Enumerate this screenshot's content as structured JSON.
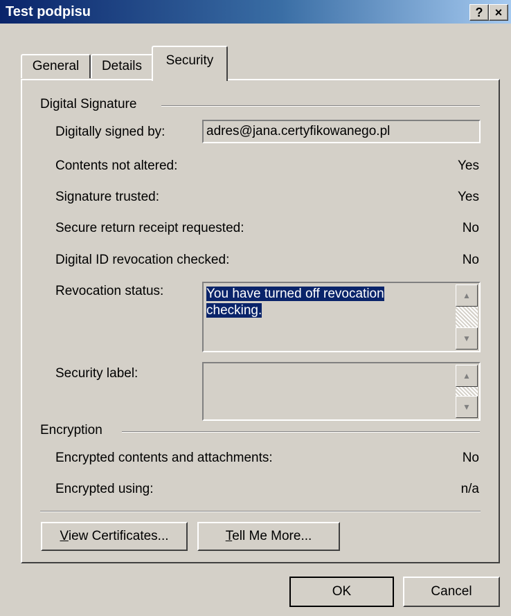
{
  "window": {
    "title": "Test podpisu",
    "help_label": "?",
    "close_label": "×"
  },
  "tabs": [
    {
      "label": "General",
      "active": false
    },
    {
      "label": "Details",
      "active": false
    },
    {
      "label": "Security",
      "active": true
    }
  ],
  "digital_signature": {
    "heading": "Digital Signature",
    "signed_by_label": "Digitally signed by:",
    "signed_by_value": "adres@jana.certyfikowanego.pl",
    "rows": [
      {
        "label": "Contents not altered:",
        "value": "Yes"
      },
      {
        "label": "Signature trusted:",
        "value": "Yes"
      },
      {
        "label": "Secure return receipt requested:",
        "value": "No"
      },
      {
        "label": "Digital ID revocation checked:",
        "value": "No"
      }
    ],
    "revocation_label": "Revocation status:",
    "revocation_text_line1": "You have turned off revocation",
    "revocation_text_line2": "checking.",
    "security_label": "Security label:"
  },
  "encryption": {
    "heading": "Encryption",
    "rows": [
      {
        "label": "Encrypted contents and attachments:",
        "value": "No"
      },
      {
        "label": "Encrypted using:",
        "value": "n/a"
      }
    ]
  },
  "buttons": {
    "view_certs_first": "V",
    "view_certs_rest": "iew Certificates...",
    "tell_me_first": "T",
    "tell_me_rest": "ell Me More...",
    "ok": "OK",
    "cancel": "Cancel"
  },
  "icons": {
    "scroll_up": "▲",
    "scroll_down": "▼"
  }
}
